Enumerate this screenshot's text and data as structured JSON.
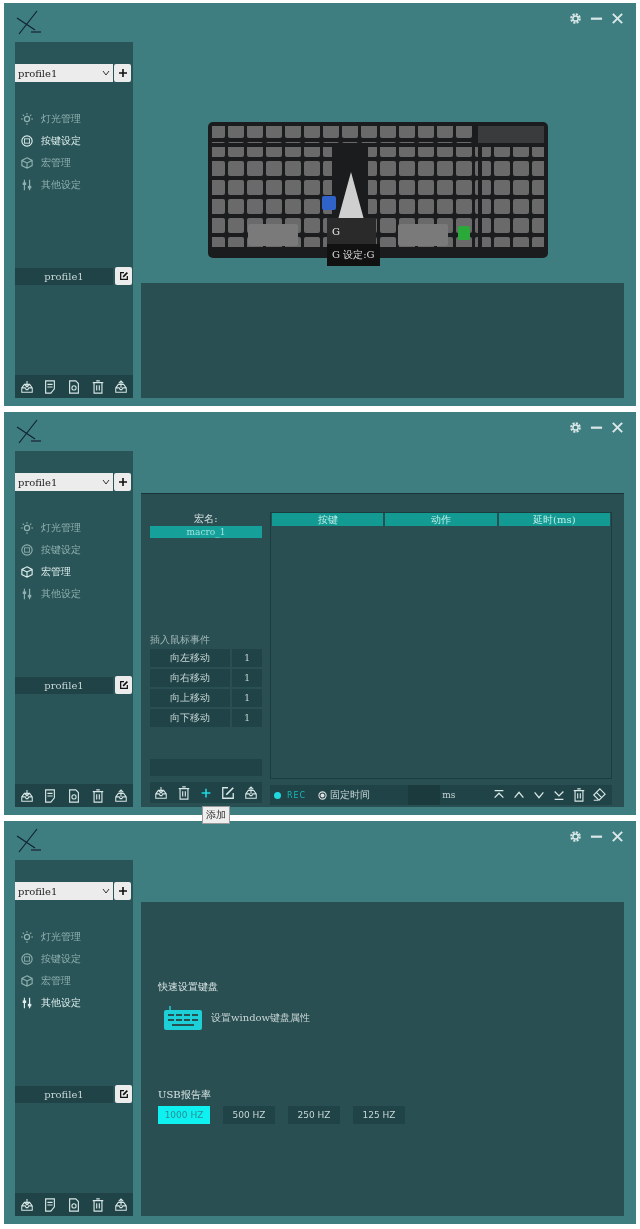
{
  "windows": [
    {
      "kind": "keyboard",
      "sidebar": {
        "profile_select": "profile1",
        "nav": [
          {
            "label": "灯光管理",
            "selected": false
          },
          {
            "label": "按键设定",
            "selected": true
          },
          {
            "label": "宏管理",
            "selected": false
          },
          {
            "label": "其他设定",
            "selected": false
          }
        ],
        "profile_name": "profile1"
      },
      "content": {
        "tooltip_key": "G",
        "tooltip_text": "G 设定:G"
      }
    },
    {
      "kind": "macro",
      "sidebar": {
        "profile_select": "profile1",
        "nav": [
          {
            "label": "灯光管理",
            "selected": false
          },
          {
            "label": "按键设定",
            "selected": false
          },
          {
            "label": "宏管理",
            "selected": true
          },
          {
            "label": "其他设定",
            "selected": false
          }
        ],
        "profile_name": "profile1"
      },
      "content": {
        "name_label": "宏名:",
        "name_value": "macro_1",
        "mouse_label": "插入鼠标事件",
        "mouse_events": [
          {
            "label": "向左移动",
            "value": "1"
          },
          {
            "label": "向右移动",
            "value": "1"
          },
          {
            "label": "向上移动",
            "value": "1"
          },
          {
            "label": "向下移动",
            "value": "1"
          }
        ],
        "tooltip": "添加",
        "columns": [
          "按键",
          "动作",
          "延时(ms)"
        ],
        "rec": "REC",
        "fixed_time": {
          "label": "固定时间",
          "selected": true
        },
        "unit": "ms"
      }
    },
    {
      "kind": "other",
      "sidebar": {
        "profile_select": "profile1",
        "nav": [
          {
            "label": "灯光管理",
            "selected": false
          },
          {
            "label": "按键设定",
            "selected": false
          },
          {
            "label": "宏管理",
            "selected": false
          },
          {
            "label": "其他设定",
            "selected": true
          }
        ],
        "profile_name": "profile1"
      },
      "content": {
        "quick_label": "快速设置键盘",
        "quick_action": "设置window键盘属性",
        "usb_label": "USB报告率",
        "rates": [
          {
            "label": "1000 HZ",
            "selected": true
          },
          {
            "label": "500 HZ",
            "selected": false
          },
          {
            "label": "250 HZ",
            "selected": false
          },
          {
            "label": "125 HZ",
            "selected": false
          }
        ]
      }
    }
  ]
}
